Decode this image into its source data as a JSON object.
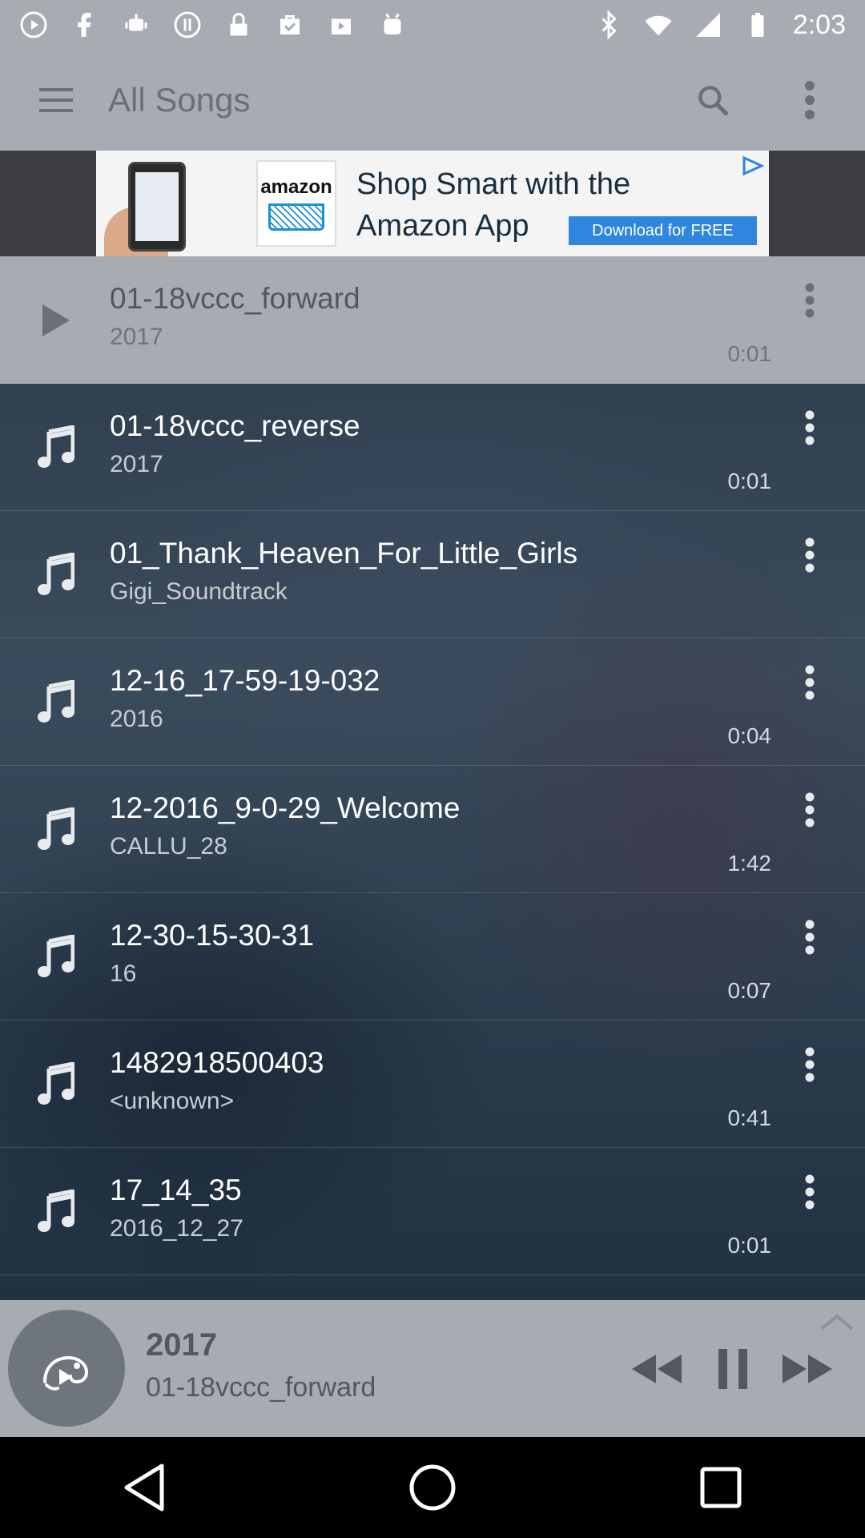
{
  "status_bar": {
    "time": "2:03",
    "left_icons": [
      "play-circle-icon",
      "facebook-icon",
      "robot-icon",
      "pause-circle-icon",
      "lock-icon",
      "check-bag-icon",
      "play-box-icon",
      "android-icon"
    ],
    "right_icons": [
      "bluetooth-icon",
      "wifi-icon",
      "signal-icon",
      "battery-icon"
    ]
  },
  "app_bar": {
    "title": "All Songs"
  },
  "ad": {
    "logo_text": "amazon",
    "headline_line1": "Shop Smart with the",
    "headline_line2": "Amazon App",
    "cta": "Download for FREE"
  },
  "songs": [
    {
      "title": "01-18vccc_forward",
      "subtitle": "2017",
      "duration": "0:01",
      "playing": true
    },
    {
      "title": "01-18vccc_reverse",
      "subtitle": "2017",
      "duration": "0:01",
      "playing": false
    },
    {
      "title": "01_Thank_Heaven_For_Little_Girls",
      "subtitle": "Gigi_Soundtrack",
      "duration": "",
      "playing": false
    },
    {
      "title": "12-16_17-59-19-032",
      "subtitle": "2016",
      "duration": "0:04",
      "playing": false
    },
    {
      "title": "12-2016_9-0-29_Welcome",
      "subtitle": "CALLU_28",
      "duration": "1:42",
      "playing": false
    },
    {
      "title": "12-30-15-30-31",
      "subtitle": "16",
      "duration": "0:07",
      "playing": false
    },
    {
      "title": "1482918500403",
      "subtitle": "<unknown>",
      "duration": "0:41",
      "playing": false
    },
    {
      "title": "17_14_35",
      "subtitle": "2016_12_27",
      "duration": "0:01",
      "playing": false
    }
  ],
  "now_playing": {
    "title": "2017",
    "subtitle": "01-18vccc_forward",
    "state": "playing"
  },
  "colors": {
    "bar_gray": "#a7acb3",
    "list_bg": "#2c3b4b",
    "ad_button": "#2e86de"
  }
}
